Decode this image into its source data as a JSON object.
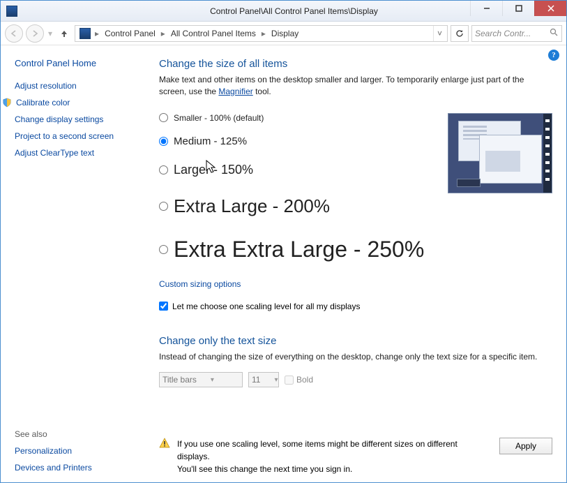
{
  "titlebar": {
    "title": "Control Panel\\All Control Panel Items\\Display"
  },
  "breadcrumb": {
    "seg1": "Control Panel",
    "seg2": "All Control Panel Items",
    "seg3": "Display"
  },
  "search": {
    "placeholder": "Search Contr..."
  },
  "sidebar": {
    "home": "Control Panel Home",
    "links": [
      "Adjust resolution",
      "Calibrate color",
      "Change display settings",
      "Project to a second screen",
      "Adjust ClearType text"
    ],
    "see_also_label": "See also",
    "see_also": [
      "Personalization",
      "Devices and Printers"
    ]
  },
  "main": {
    "heading1": "Change the size of all items",
    "desc_pre": "Make text and other items on the desktop smaller and larger. To temporarily enlarge just part of the screen, use the ",
    "desc_link": "Magnifier",
    "desc_post": " tool.",
    "options": [
      "Smaller - 100% (default)",
      "Medium - 125%",
      "Larger - 150%",
      "Extra Large - 200%",
      "Extra Extra Large - 250%"
    ],
    "selected_index": 1,
    "custom_link": "Custom sizing options",
    "checkbox_label": "Let me choose one scaling level for all my displays",
    "heading2": "Change only the text size",
    "desc2": "Instead of changing the size of everything on the desktop, change only the text size for a specific item.",
    "textsize_item": "Title bars",
    "textsize_value": "11",
    "bold_label": "Bold",
    "warning_line1": "If you use one scaling level, some items might be different sizes on different displays.",
    "warning_line2": "You'll see this change the next time you sign in.",
    "apply_label": "Apply"
  },
  "help_icon": "?"
}
